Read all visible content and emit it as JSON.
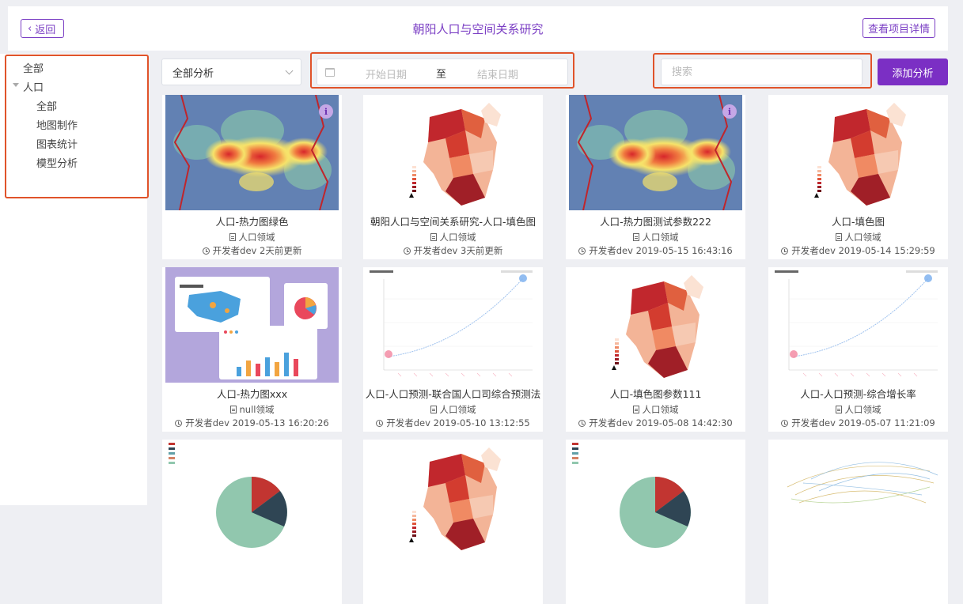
{
  "header": {
    "back_label": "返回",
    "title": "朝阳人口与空间关系研究",
    "detail_label": "查看项目详情"
  },
  "sidebar": {
    "items": [
      {
        "label": "全部"
      },
      {
        "label": "人口"
      },
      {
        "label": "全部"
      },
      {
        "label": "地图制作"
      },
      {
        "label": "图表统计"
      },
      {
        "label": "模型分析"
      }
    ]
  },
  "filters": {
    "analysis_select": "全部分析",
    "start_placeholder": "开始日期",
    "range_separator": "至",
    "end_placeholder": "结束日期",
    "search_placeholder": "搜索",
    "add_label": "添加分析"
  },
  "colors": {
    "accent": "#7b2fc4",
    "highlight": "#e0532a"
  },
  "cards": [
    {
      "title": "人口-热力图绿色",
      "field": "人口领域",
      "meta": "开发者dev 2天前更新",
      "thumb": "heatmap"
    },
    {
      "title": "朝阳人口与空间关系研究-人口-填色图",
      "field": "人口领域",
      "meta": "开发者dev 3天前更新",
      "thumb": "choropleth"
    },
    {
      "title": "人口-热力图测试参数222",
      "field": "人口领域",
      "meta": "开发者dev 2019-05-15 16:43:16",
      "thumb": "heatmap"
    },
    {
      "title": "人口-填色图",
      "field": "人口领域",
      "meta": "开发者dev 2019-05-14 15:29:59",
      "thumb": "choropleth"
    },
    {
      "title": "人口-热力图xxx",
      "field": "null领域",
      "meta": "开发者dev 2019-05-13 16:20:26",
      "thumb": "illustration"
    },
    {
      "title": "人口-人口预测-联合国人口司综合预测法",
      "field": "人口领域",
      "meta": "开发者dev 2019-05-10 13:12:55",
      "thumb": "curve"
    },
    {
      "title": "人口-填色图参数111",
      "field": "人口领域",
      "meta": "开发者dev 2019-05-08 14:42:30",
      "thumb": "choropleth"
    },
    {
      "title": "人口-人口预测-综合增长率",
      "field": "人口领域",
      "meta": "开发者dev 2019-05-07 11:21:09",
      "thumb": "curve"
    },
    {
      "title": "",
      "field": "",
      "meta": "",
      "thumb": "pie"
    },
    {
      "title": "",
      "field": "",
      "meta": "",
      "thumb": "choropleth"
    },
    {
      "title": "",
      "field": "",
      "meta": "",
      "thumb": "pie"
    },
    {
      "title": "",
      "field": "",
      "meta": "",
      "thumb": "network"
    }
  ]
}
